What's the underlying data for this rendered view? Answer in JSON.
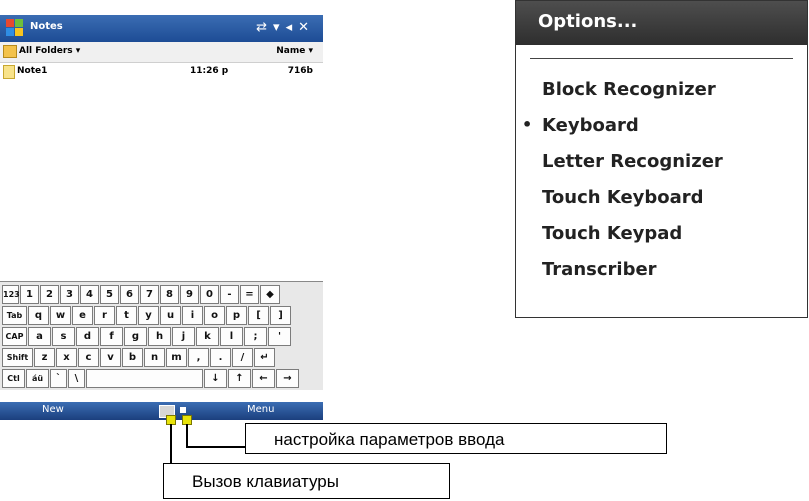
{
  "device": {
    "app_title": "Notes",
    "toolbar": {
      "folders": "All Folders ▾",
      "sort": "Name ▾"
    },
    "file": {
      "name": "Note1",
      "time": "11:26 p",
      "size": "716b"
    },
    "menubar": {
      "new": "New",
      "menu": "Menu"
    },
    "keyboard_rows": [
      [
        "123",
        "1",
        "2",
        "3",
        "4",
        "5",
        "6",
        "7",
        "8",
        "9",
        "0",
        "-",
        "=",
        "◆"
      ],
      [
        "Tab",
        "q",
        "w",
        "e",
        "r",
        "t",
        "y",
        "u",
        "i",
        "o",
        "p",
        "[",
        "]"
      ],
      [
        "CAP",
        "a",
        "s",
        "d",
        "f",
        "g",
        "h",
        "j",
        "k",
        "l",
        ";",
        "'"
      ],
      [
        "Shift",
        "z",
        "x",
        "c",
        "v",
        "b",
        "n",
        "m",
        ",",
        ".",
        "/",
        "↵"
      ],
      [
        "Ctl",
        "áü",
        "`",
        "\\",
        "",
        "↓",
        "↑",
        "←",
        "→"
      ]
    ]
  },
  "options_menu": {
    "title": "Options...",
    "items": [
      {
        "label": "Block Recognizer",
        "selected": false
      },
      {
        "label": "Keyboard",
        "selected": true
      },
      {
        "label": "Letter Recognizer",
        "selected": false
      },
      {
        "label": "Touch Keyboard",
        "selected": false
      },
      {
        "label": "Touch Keypad",
        "selected": false
      },
      {
        "label": "Transcriber",
        "selected": false
      }
    ]
  },
  "callouts": {
    "input_settings": "настройка параметров ввода",
    "keyboard_call": "Вызов клавиатуры"
  },
  "colors": {
    "title_bar": "#1d4c95",
    "marker": "#e8e30a",
    "options_header": "#3a3a3a"
  }
}
